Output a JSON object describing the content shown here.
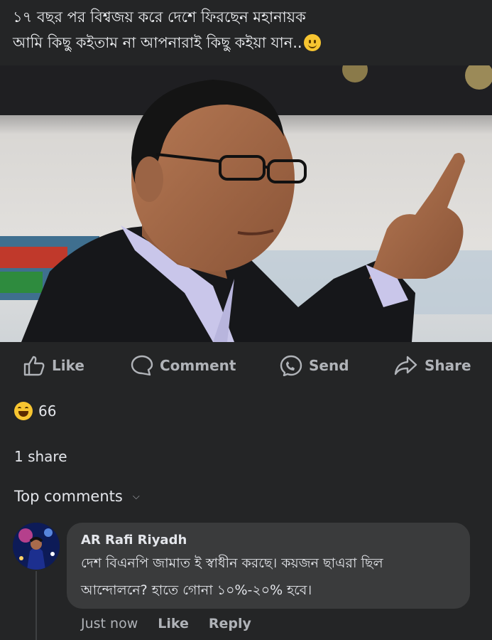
{
  "post": {
    "text_line1": "১৭ বছর পর বিশ্বজয় করে দেশে ফিরছেন মহানায়ক",
    "text_line2": "আমি কিছু কইতাম না আপনারাই কিছু কইয়া যান..",
    "emoji": "slightly-smiling-face"
  },
  "actions": {
    "like": "Like",
    "comment": "Comment",
    "send": "Send",
    "share": "Share"
  },
  "reactions": {
    "type": "haha",
    "count": "66"
  },
  "shares_text": "1 share",
  "comments_filter": "Top comments",
  "comment": {
    "author": "AR Rafi Riyadh",
    "line1": "দেশ বিএনপি জামাত ই স্বাধীন করছে। কয়জন ছাএরা ছিল",
    "line2": "আন্দোলনে? হাতে গোনা ১০%-২০% হবে।",
    "time": "Just now",
    "like": "Like",
    "reply": "Reply"
  },
  "colors": {
    "background": "#242526",
    "bubble": "#3a3b3c",
    "secondary_text": "#b0b3b8"
  }
}
